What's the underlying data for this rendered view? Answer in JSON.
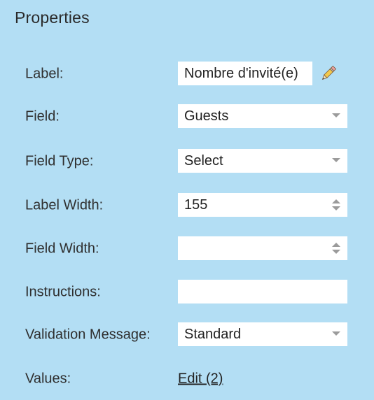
{
  "panel": {
    "title": "Properties"
  },
  "fields": {
    "label": {
      "label": "Label:",
      "value": "Nombre d'invité(e)"
    },
    "field": {
      "label": "Field:",
      "value": "Guests"
    },
    "field_type": {
      "label": "Field Type:",
      "value": "Select"
    },
    "label_width": {
      "label": "Label Width:",
      "value": "155"
    },
    "field_width": {
      "label": "Field Width:",
      "value": ""
    },
    "instructions": {
      "label": "Instructions:",
      "value": ""
    },
    "validation_message": {
      "label": "Validation Message:",
      "value": "Standard"
    },
    "values": {
      "label": "Values:",
      "link": "Edit (2)"
    }
  },
  "icons": {
    "edit": "pencil-icon",
    "dropdown": "chevron-down-icon",
    "spinner": "spinner-arrows-icon"
  },
  "colors": {
    "panel_bg": "#b3def4",
    "input_bg": "#ffffff",
    "text": "#2f2f2f",
    "arrow": "#9b9b9b"
  }
}
